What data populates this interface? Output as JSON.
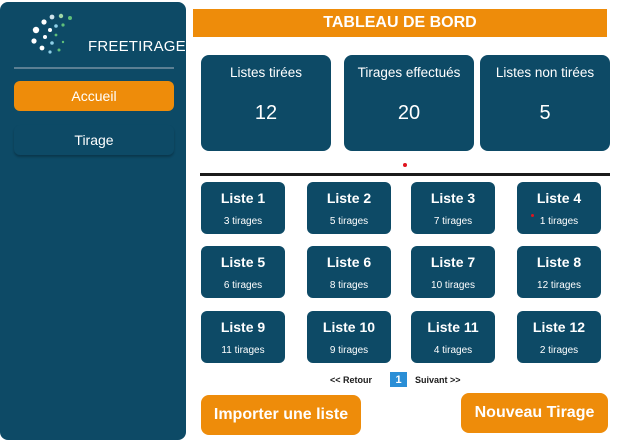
{
  "brand": {
    "logo_text": "FREETIRAGE",
    "accent": "#ee8c0a",
    "navy": "#0d4a66"
  },
  "sidebar": {
    "items": [
      {
        "label": "Accueil",
        "active": true
      },
      {
        "label": "Tirage",
        "active": false
      }
    ]
  },
  "header": {
    "title": "TABLEAU DE BORD"
  },
  "stats": [
    {
      "label": "Listes tirées",
      "value": "12"
    },
    {
      "label": "Tirages effectués",
      "value": "20"
    },
    {
      "label": "Listes non tirées",
      "value": "5"
    }
  ],
  "lists": [
    {
      "title": "Liste 1",
      "subtitle": "3 tirages"
    },
    {
      "title": "Liste 2",
      "subtitle": "5 tirages"
    },
    {
      "title": "Liste 3",
      "subtitle": "7 tirages"
    },
    {
      "title": "Liste 4",
      "subtitle": "1 tirages"
    },
    {
      "title": "Liste 5",
      "subtitle": "6 tirages"
    },
    {
      "title": "Liste 6",
      "subtitle": "8 tirages"
    },
    {
      "title": "Liste 7",
      "subtitle": "10 tirages"
    },
    {
      "title": "Liste 8",
      "subtitle": "12 tirages"
    },
    {
      "title": "Liste 9",
      "subtitle": "11 tirages"
    },
    {
      "title": "Liste 10",
      "subtitle": "9 tirages"
    },
    {
      "title": "Liste 11",
      "subtitle": "4 tirages"
    },
    {
      "title": "Liste 12",
      "subtitle": "2 tirages"
    }
  ],
  "pagination": {
    "prev_label": "<< Retour",
    "current_page": "1",
    "next_label": "Suivant >>"
  },
  "actions": {
    "import_label": "Importer une liste",
    "new_label": "Nouveau Tirage"
  }
}
